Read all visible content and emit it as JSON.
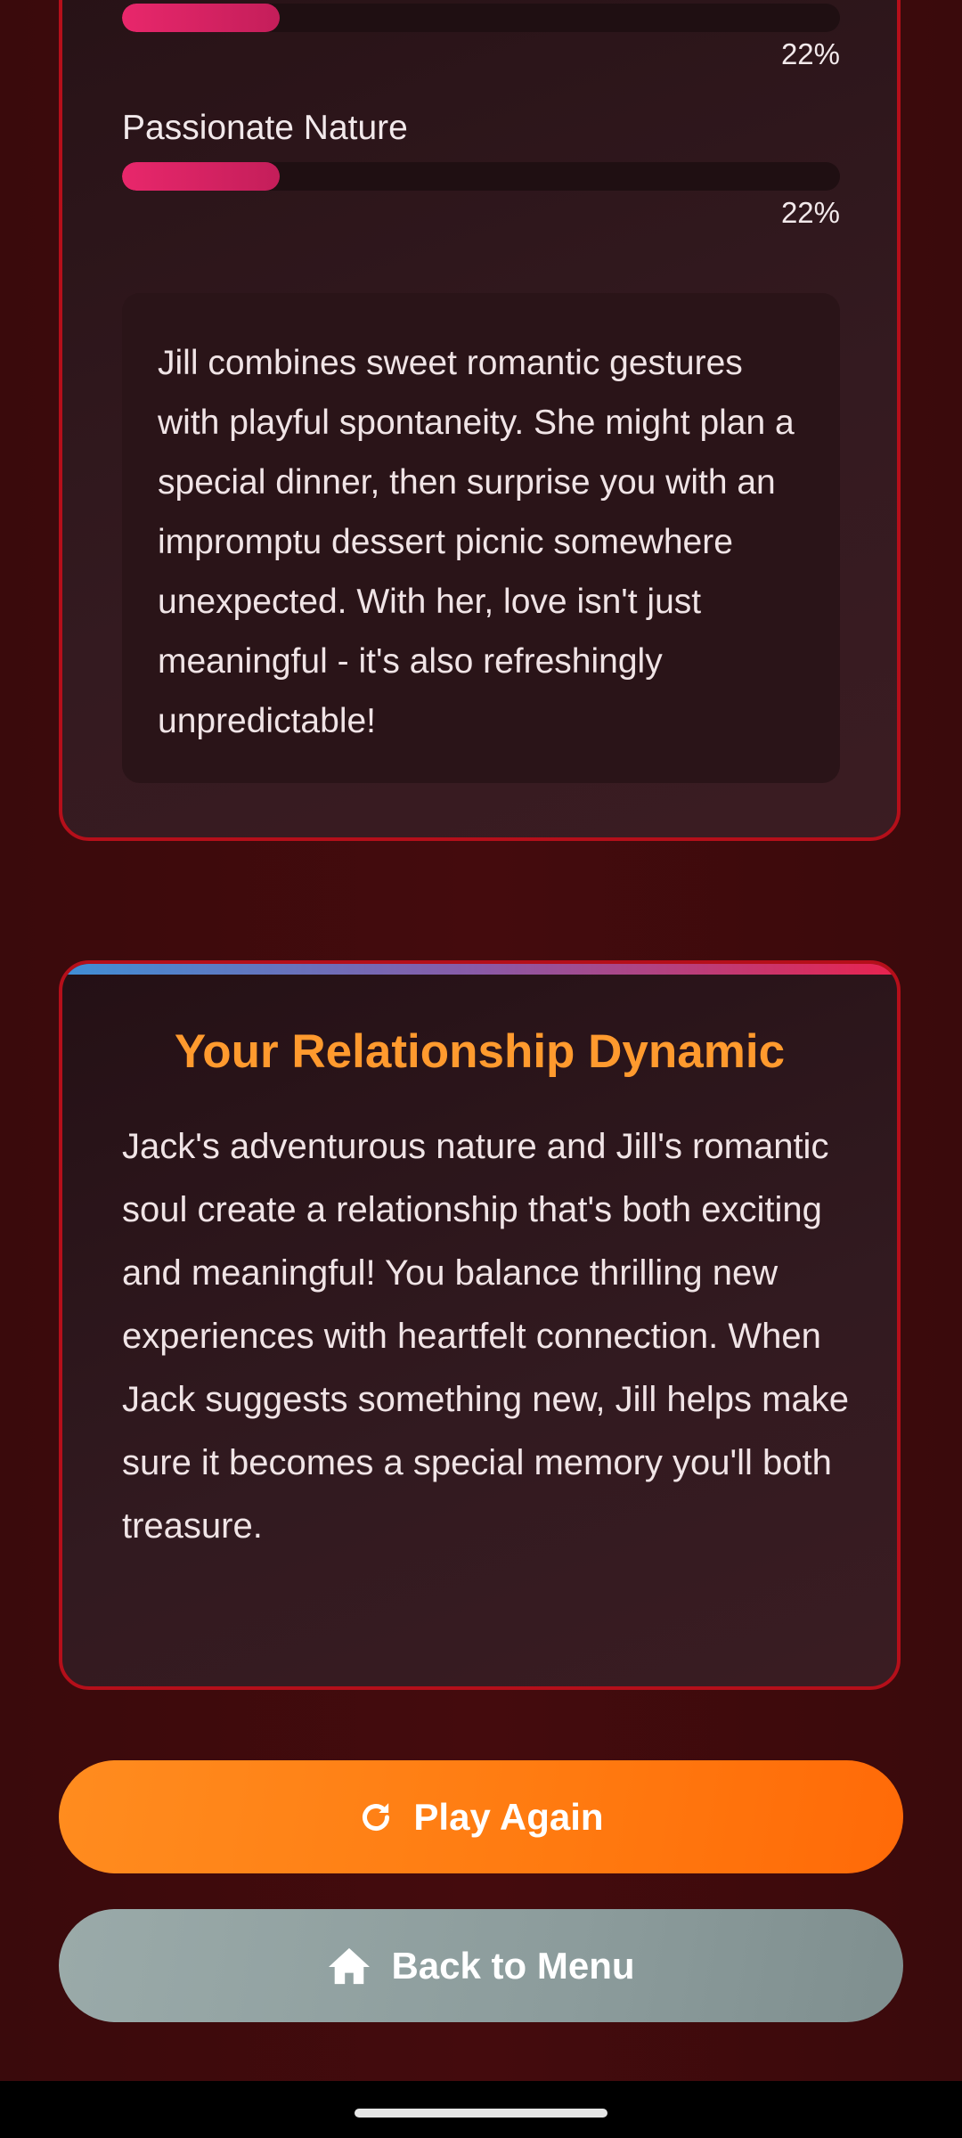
{
  "profile": {
    "traits": [
      {
        "name": "",
        "percent_label": "22%",
        "value": 0.22
      },
      {
        "name": "Passionate Nature",
        "percent_label": "22%",
        "value": 0.22
      }
    ],
    "description": "Jill combines sweet romantic gestures with playful spontaneity. She might plan a special dinner, then surprise you with an impromptu dessert picnic somewhere unexpected. With her, love isn't just meaningful - it's also refreshingly unpredictable!"
  },
  "dynamic": {
    "title": "Your Relationship Dynamic",
    "text": "Jack's adventurous nature and Jill's romantic soul create a relationship that's both exciting and meaningful! You balance thrilling new experiences with heartfelt connection. When Jack suggests something new, Jill helps make sure it becomes a special memory you'll both treasure."
  },
  "buttons": {
    "play_again": {
      "label": "Play Again",
      "icon": "refresh-icon"
    },
    "back_to_menu": {
      "label": "Back to Menu",
      "icon": "home-icon"
    }
  },
  "colors": {
    "accent_orange": "#ff9a2e",
    "card_border": "#b50f1a",
    "bar_pink": "#e8276b",
    "menu_button_gray": "#8c9c9c"
  }
}
